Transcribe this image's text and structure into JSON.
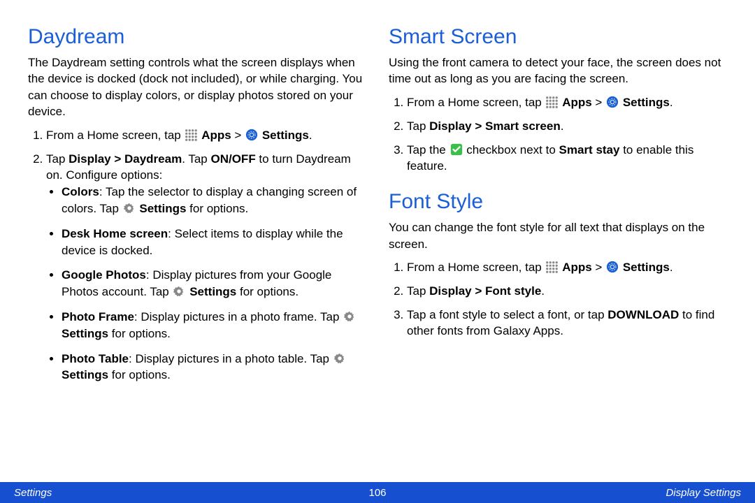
{
  "left": {
    "heading": "Daydream",
    "intro": "The Daydream setting controls what the screen displays when the device is docked (dock not included), or while charging. You can choose to display colors, or display photos stored on your device.",
    "step1_a": "From a Home screen, tap ",
    "step1_apps": "Apps",
    "step1_gt": " > ",
    "step1_settings": "Settings",
    "step1_dot": ".",
    "step2_a": "Tap ",
    "step2_b": "Display > Daydream",
    "step2_c": ". Tap ",
    "step2_d": "ON/OFF",
    "step2_e": " to turn Daydream on. Configure options:",
    "b1_a": "Colors",
    "b1_b": ": Tap the selector to display a changing screen of colors. Tap ",
    "b1_c": "Settings",
    "b1_d": " for options.",
    "b2_a": "Desk Home screen",
    "b2_b": ": Select items to display while the device is docked.",
    "b3_a": "Google Photos",
    "b3_b": ": Display pictures from your Google Photos account. Tap ",
    "b3_c": "Settings",
    "b3_d": " for options.",
    "b4_a": "Photo Frame",
    "b4_b": ": Display pictures in a photo frame. Tap ",
    "b4_c": "Settings",
    "b4_d": " for options.",
    "b5_a": "Photo Table",
    "b5_b": ": Display pictures in a photo table. Tap ",
    "b5_c": "Settings",
    "b5_d": " for options."
  },
  "rightA": {
    "heading": "Smart Screen",
    "intro": "Using the front camera to detect your face, the screen does not time out as long as you are facing the screen.",
    "s1_a": "From a Home screen, tap ",
    "s1_apps": "Apps",
    "s1_gt": " > ",
    "s1_settings": "Settings",
    "s1_dot": ".",
    "s2_a": "Tap ",
    "s2_b": "Display > Smart screen",
    "s2_c": ".",
    "s3_a": "Tap the ",
    "s3_b": " checkbox next to ",
    "s3_c": "Smart stay",
    "s3_d": " to enable this feature."
  },
  "rightB": {
    "heading": "Font Style",
    "intro": "You can change the font style for all text that displays on the screen.",
    "s1_a": "From a Home screen, tap ",
    "s1_apps": "Apps",
    "s1_gt": " > ",
    "s1_settings": "Settings",
    "s1_dot": ".",
    "s2_a": "Tap ",
    "s2_b": "Display > Font style",
    "s2_c": ".",
    "s3_a": "Tap a font style to select a font, or tap ",
    "s3_b": "DOWNLOAD",
    "s3_c": " to find other fonts from Galaxy Apps."
  },
  "footer": {
    "left": "Settings",
    "page": "106",
    "right": "Display Settings"
  }
}
